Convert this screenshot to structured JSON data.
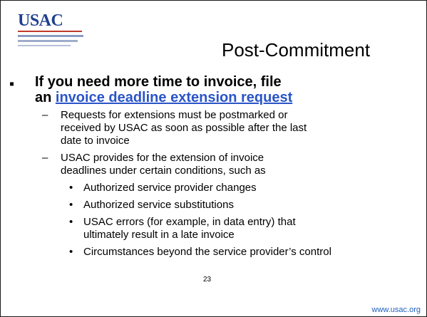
{
  "logo": {
    "text": "USAC"
  },
  "title": "Post-Commitment",
  "main_point": {
    "bullet": "▪",
    "text_line1": "If you need more time to invoice, file",
    "text_line2_prefix": "an ",
    "link_text": "invoice deadline extension request"
  },
  "sub_points": [
    {
      "marker": "–",
      "lines": [
        "Requests for extensions must be postmarked or",
        "received by USAC as soon as possible after the last",
        "date to invoice"
      ]
    },
    {
      "marker": "–",
      "lines": [
        "USAC provides for the extension of invoice",
        "deadlines under certain conditions, such as"
      ]
    }
  ],
  "conditions": [
    {
      "marker": "•",
      "lines": [
        "Authorized service provider changes"
      ]
    },
    {
      "marker": "•",
      "lines": [
        "Authorized service substitutions"
      ]
    },
    {
      "marker": "•",
      "lines": [
        "USAC errors (for example, in data entry) that",
        "ultimately result in a late invoice"
      ]
    },
    {
      "marker": "•",
      "lines": [
        "Circumstances beyond the service provider’s control"
      ]
    }
  ],
  "page_number": "23",
  "footer_url": "www.usac.org"
}
